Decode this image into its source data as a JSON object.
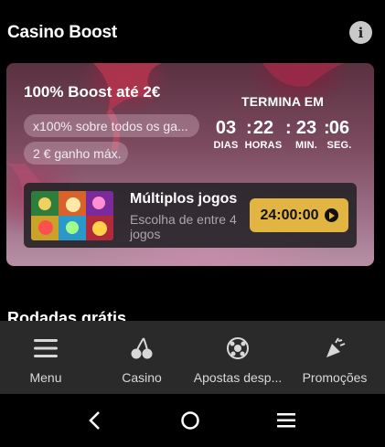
{
  "header": {
    "title": "Casino Boost",
    "info_icon": "info-icon"
  },
  "boost_card": {
    "title": "100% Boost até 2€",
    "pills": [
      "x100% sobre todos os ga...",
      "2 € ganho máx."
    ],
    "ends_label": "TERMINA EM",
    "countdown": {
      "days": "03",
      "days_label": "DIAS",
      "hours": "22",
      "hours_label": "HORAS",
      "minutes": "23",
      "minutes_label": "MIN.",
      "seconds": "06",
      "seconds_label": "SEG.",
      "separator": ":"
    },
    "game": {
      "title": "Múltiplos jogos",
      "subtitle": "Escolha de entre 4 jogos",
      "timer": "24:00:00",
      "play_icon": "play-circle-icon"
    }
  },
  "section_title": "Rodadas grátis",
  "bottom_nav": {
    "items": [
      {
        "label": "Menu",
        "icon": "menu-icon"
      },
      {
        "label": "Casino",
        "icon": "cherry-icon"
      },
      {
        "label": "Apostas desp...",
        "icon": "sports-ball-icon"
      },
      {
        "label": "Promoções",
        "icon": "party-popper-icon"
      }
    ]
  },
  "system_nav": {
    "back_icon": "back-icon",
    "home_icon": "home-icon",
    "recents_icon": "recents-icon"
  },
  "colors": {
    "background": "#000000",
    "nav_bg": "#2a2a2a",
    "accent": "#e2b441"
  }
}
